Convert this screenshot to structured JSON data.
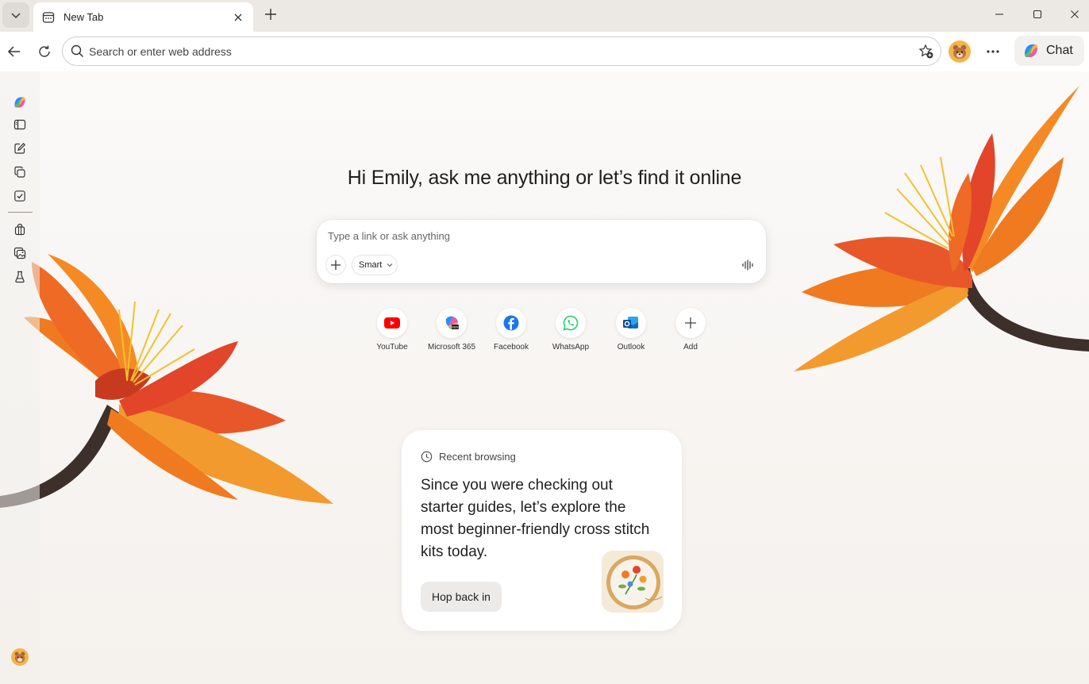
{
  "tabs": [
    {
      "title": "New Tab"
    }
  ],
  "toolbar": {
    "address_placeholder": "Search or enter web address",
    "chat_label": "Chat"
  },
  "page": {
    "greeting": "Hi Emily, ask me anything or let’s find it online",
    "ask_placeholder": "Type a link or ask anything",
    "mode_label": "Smart",
    "shortcuts": [
      {
        "label": "YouTube",
        "icon": "youtube-icon"
      },
      {
        "label": "Microsoft 365",
        "icon": "microsoft365-icon"
      },
      {
        "label": "Facebook",
        "icon": "facebook-icon"
      },
      {
        "label": "WhatsApp",
        "icon": "whatsapp-icon"
      },
      {
        "label": "Outlook",
        "icon": "outlook-icon"
      },
      {
        "label": "Add",
        "icon": "plus-icon"
      }
    ],
    "recent": {
      "header": "Recent browsing",
      "body": "Since you were checking out starter guides, let’s explore the most beginner-friendly cross stitch kits today.",
      "button": "Hop back in"
    }
  },
  "colors": {
    "accent_orange": "#f07a1f",
    "petal_red": "#e2452a",
    "stem_brown": "#3d2f2a",
    "youtube_red": "#ff0000",
    "facebook_blue": "#1877f2",
    "whatsapp_green": "#25d366",
    "outlook_blue": "#0f6cbd"
  }
}
